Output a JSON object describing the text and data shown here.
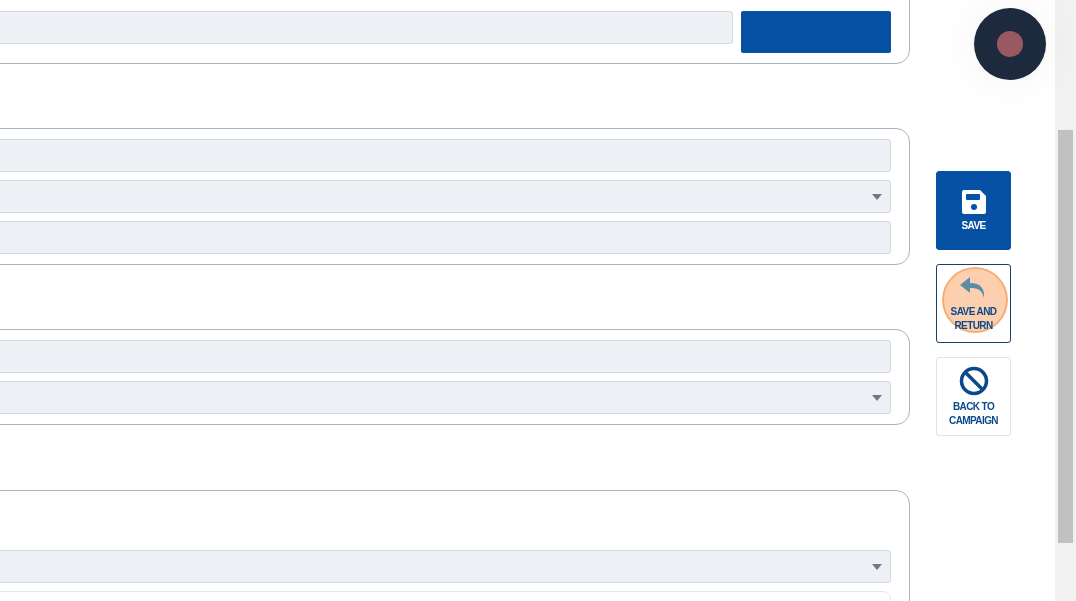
{
  "cards": [
    {
      "fields": [
        {
          "kind": "input"
        },
        {
          "kind": "button"
        }
      ]
    },
    {
      "fields": [
        {
          "kind": "input"
        },
        {
          "kind": "select"
        },
        {
          "kind": "input"
        }
      ]
    },
    {
      "fields": [
        {
          "kind": "input"
        },
        {
          "kind": "select"
        }
      ]
    },
    {
      "fields": [
        {
          "kind": "spacer"
        },
        {
          "kind": "select"
        },
        {
          "kind": "textarea"
        }
      ]
    }
  ],
  "actions": [
    {
      "label": "SAVE",
      "kind": "primary",
      "pointer_highlight": false
    },
    {
      "label": "SAVE AND RETURN",
      "kind": "outlined",
      "pointer_highlight": true
    },
    {
      "label": "BACK TO CAMPAIGN",
      "kind": "plain",
      "pointer_highlight": false
    }
  ]
}
